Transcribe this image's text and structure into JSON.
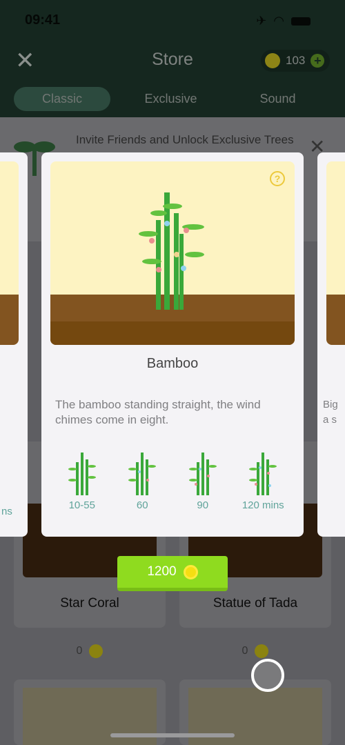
{
  "status_bar": {
    "time": "09:41",
    "icons": [
      "airplane-icon",
      "wifi-icon",
      "battery-icon"
    ]
  },
  "header": {
    "title": "Store",
    "coins": "103"
  },
  "tabs": [
    {
      "label": "Classic",
      "active": true
    },
    {
      "label": "Exclusive",
      "active": false
    },
    {
      "label": "Sound",
      "active": false
    }
  ],
  "banner": {
    "text": "Invite Friends and Unlock Exclusive Trees"
  },
  "grid": [
    {
      "name": "Star Coral",
      "price": "0"
    },
    {
      "name": "Statue of Tada",
      "price": "0"
    }
  ],
  "modal": {
    "name": "Bamboo",
    "description": "The bamboo standing straight, the wind chimes come in eight.",
    "stages": [
      "10-55",
      "60",
      "90",
      "120 mins"
    ],
    "price": "1200"
  },
  "side_cards": {
    "left_stage": "ns",
    "right_desc": "Big\na s"
  },
  "colors": {
    "buy_button": "#8fdb1f",
    "stage_label": "#5fa39a",
    "header": "#15271f"
  }
}
